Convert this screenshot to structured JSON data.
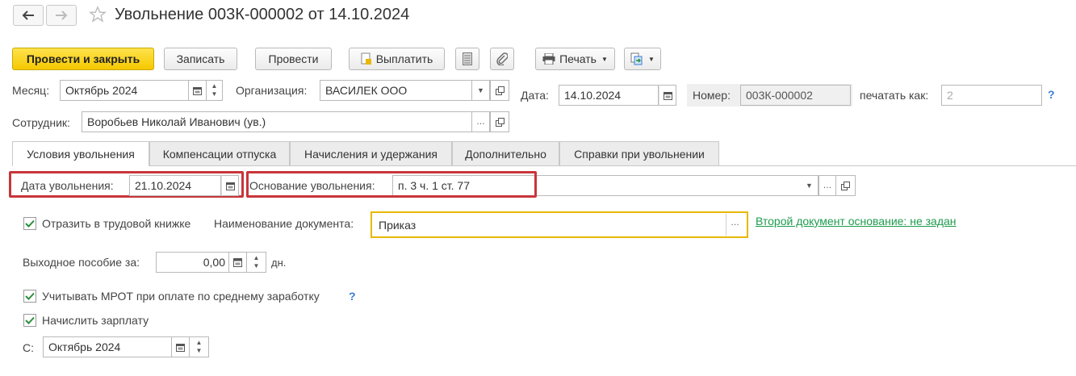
{
  "title": "Увольнение 003К-000002 от 14.10.2024",
  "toolbar": {
    "post_close": "Провести и закрыть",
    "save": "Записать",
    "post": "Провести",
    "pay": "Выплатить",
    "print": "Печать"
  },
  "header": {
    "month_label": "Месяц:",
    "month_value": "Октябрь 2024",
    "org_label": "Организация:",
    "org_value": "ВАСИЛЕК ООО",
    "date_label": "Дата:",
    "date_value": "14.10.2024",
    "number_label": "Номер:",
    "number_value": "003К-000002",
    "print_as_label": "печатать как:",
    "print_as_placeholder": "2",
    "help": "?",
    "employee_label": "Сотрудник:",
    "employee_value": "Воробьев Николай Иванович (ув.)"
  },
  "tabs": [
    {
      "label": "Условия увольнения"
    },
    {
      "label": "Компенсации отпуска"
    },
    {
      "label": "Начисления и удержания"
    },
    {
      "label": "Дополнительно"
    },
    {
      "label": "Справки при увольнении"
    }
  ],
  "form": {
    "dismissal_date_label": "Дата увольнения:",
    "dismissal_date_value": "21.10.2024",
    "reason_label": "Основание увольнения:",
    "reason_value": "п. 3 ч. 1 ст. 77",
    "workbook_label": "Отразить в трудовой книжке",
    "workbook_checked": true,
    "doc_name_label": "Наименование документа:",
    "doc_name_value": "Приказ",
    "second_doc_link": "Второй документ основание: не задан",
    "severance_label": "Выходное пособие за:",
    "severance_value": "0,00",
    "severance_unit": "дн.",
    "mrot_label": "Учитывать МРОТ при оплате по среднему заработку",
    "mrot_checked": true,
    "mrot_help": "?",
    "salary_label": "Начислить зарплату",
    "salary_checked": true,
    "from_label": "С:",
    "from_value": "Октябрь 2024"
  },
  "colors": {
    "primary_button": "#f5c800",
    "highlight": "#c9353a",
    "link": "#1e9c4e",
    "focus_border": "#e8b800"
  }
}
